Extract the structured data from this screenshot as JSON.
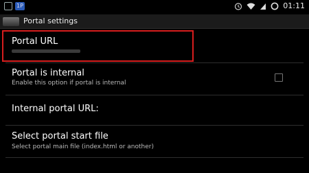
{
  "status_bar": {
    "notification_badge": "1P",
    "time": "01:11",
    "icons": [
      "notification-icon",
      "alarm-icon",
      "wifi-icon",
      "signal-icon",
      "battery-icon"
    ]
  },
  "action_bar": {
    "title": "Portal settings"
  },
  "preferences": [
    {
      "title": "Portal URL",
      "summary": ""
    },
    {
      "title": "Portal is internal",
      "summary": "Enable this option if portal is internal",
      "checked": false
    },
    {
      "title": "Internal portal URL:",
      "summary": ""
    },
    {
      "title": "Select portal start file",
      "summary": "Select portal main file (index.html or another)"
    }
  ],
  "colors": {
    "highlight": "#d81e1e",
    "background": "#000000"
  }
}
